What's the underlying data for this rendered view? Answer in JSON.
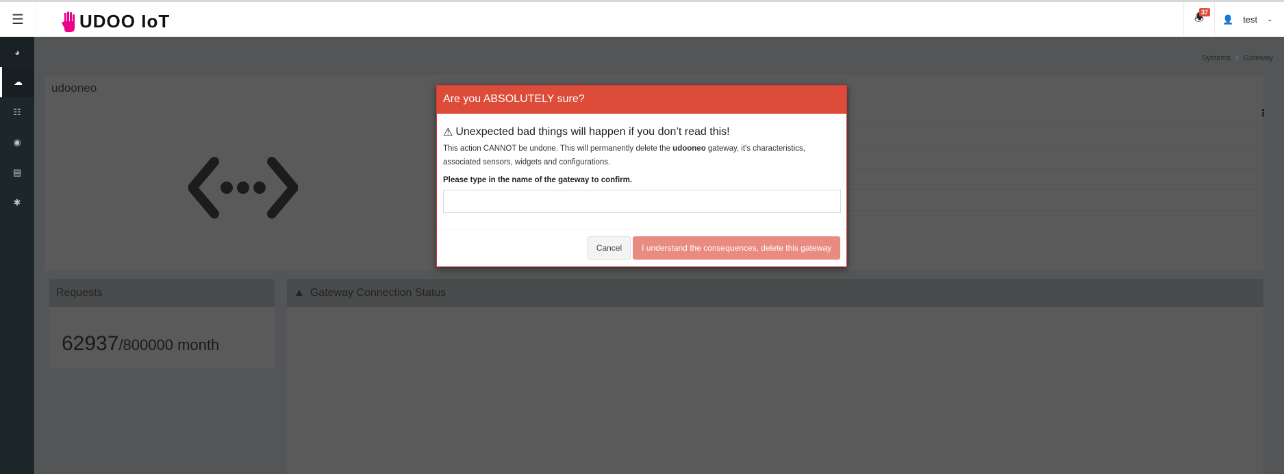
{
  "header": {
    "brand": "UDOO IoT",
    "notifications_count": "37",
    "username": "test"
  },
  "sidebar": {
    "items": [
      {
        "icon": "dashboard-icon"
      },
      {
        "icon": "cloud-icon",
        "active": true
      },
      {
        "icon": "sitemap-icon"
      },
      {
        "icon": "toggle-icon"
      },
      {
        "icon": "book-icon"
      },
      {
        "icon": "bug-icon"
      }
    ]
  },
  "breadcrumb": {
    "items": [
      "Systems",
      "Gateway"
    ]
  },
  "gateway": {
    "name": "udooneo"
  },
  "requests": {
    "title": "Requests",
    "count": "62937",
    "limit": "/800000 month"
  },
  "connection_status": {
    "title": "Gateway Connection Status"
  },
  "modal": {
    "title": "Are you ABSOLUTELY sure?",
    "warning": "Unexpected bad things will happen if you don’t read this!",
    "text_before": "This action CANNOT be undone. This will permanently delete the ",
    "gateway_name": "udooneo",
    "text_after": " gateway, it's characteristics, associated sensors, widgets and configurations.",
    "confirm_label": "Please type in the name of the gateway to confirm.",
    "input_value": "",
    "cancel": "Cancel",
    "delete": "I understand the consequences, delete this gateway"
  },
  "colors": {
    "danger": "#dd4b39",
    "brand_pink": "#ec008c",
    "sidebar": "#222d32"
  }
}
